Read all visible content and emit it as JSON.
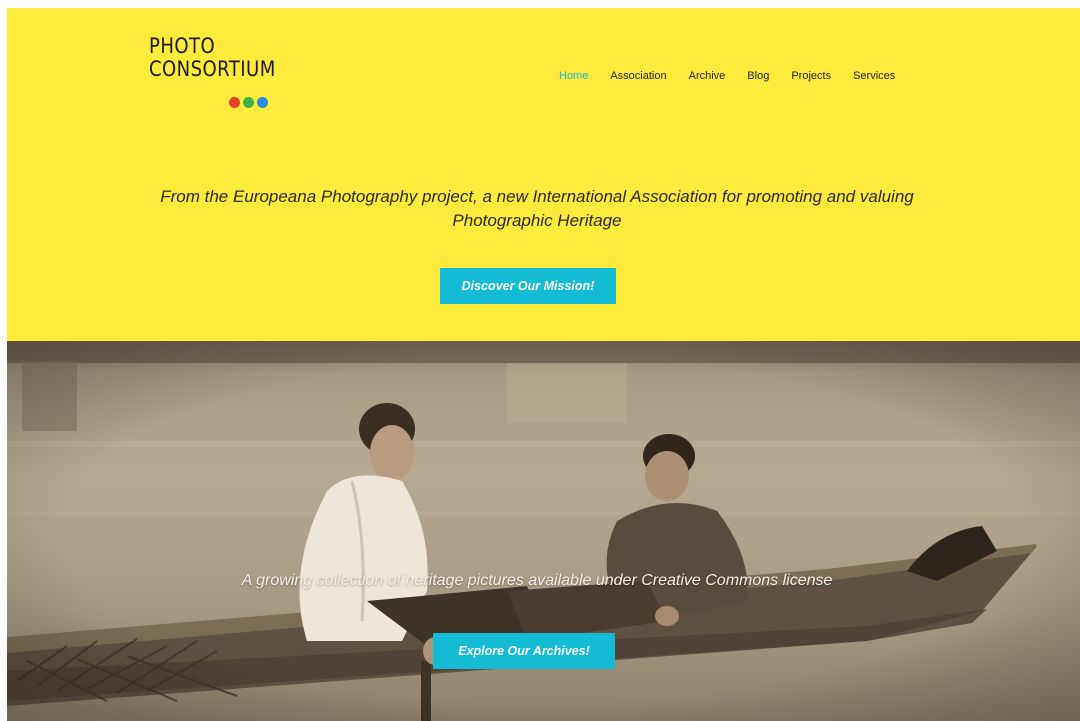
{
  "logo": {
    "line1": "PHOTO",
    "line2": "CONSORTIUM",
    "dot_colors": [
      "#e8412f",
      "#3cb24a",
      "#2b8ae6"
    ]
  },
  "nav": {
    "items": [
      {
        "label": "Home",
        "active": true
      },
      {
        "label": "Association",
        "active": false
      },
      {
        "label": "Archive",
        "active": false
      },
      {
        "label": "Blog",
        "active": false
      },
      {
        "label": "Projects",
        "active": false
      },
      {
        "label": "Services",
        "active": false
      }
    ]
  },
  "hero": {
    "tagline": "From the Europeana Photography project, a new International Association for promoting and valuing Photographic Heritage",
    "cta_label": "Discover Our Mission!"
  },
  "photo_section": {
    "caption": "A growing collection of heritage pictures available under Creative Commons license",
    "cta_label": "Explore Our Archives!"
  },
  "colors": {
    "hero_background": "#ffeb3b",
    "accent": "#13bcd4",
    "nav_active": "#1fb7d6",
    "sepia": "#9c8b72"
  }
}
